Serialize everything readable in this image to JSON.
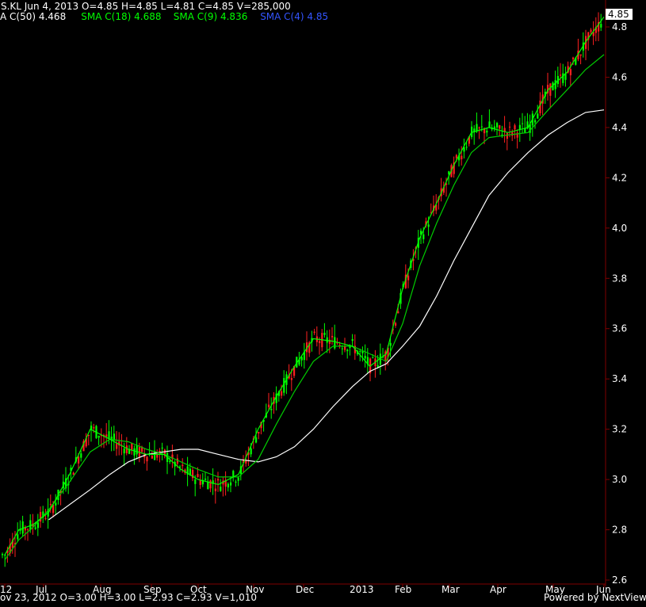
{
  "header": {
    "line1": "S.KL Jun 4, 2013   O=4.85   H=4.85   L=4.81   C=4.85   V=285,000",
    "sma_labels": [
      {
        "text": "A C(50) 4.468",
        "color": "#ffffff"
      },
      {
        "text": "SMA C(18) 4.688",
        "color": "#00ff00"
      },
      {
        "text": "SMA C(9) 4.836",
        "color": "#00ff00"
      },
      {
        "text": "SMA C(4) 4.85",
        "color": "#3355ff"
      }
    ]
  },
  "footer": {
    "hover_line": "ov 23, 2012   O=3.00   H=3.00   L=2.93   C=2.93   V=1,010",
    "powered_by": "Powered by NextView"
  },
  "colors": {
    "background": "#000000",
    "up_candle": "#00ff00",
    "down_candle": "#ff2020",
    "sma50": "#ffffff",
    "sma18": "#00cc00",
    "sma9": "#00ff00",
    "axis": "#800000",
    "text": "#ffffff",
    "last_price_box": "#ffffff"
  },
  "chart_data": {
    "type": "line",
    "title": "S.KL",
    "x_ticks": [
      "12",
      "Jul",
      "Aug",
      "Sep",
      "Oct",
      "Nov",
      "Dec",
      "2013",
      "Feb",
      "Mar",
      "Apr",
      "May",
      "Jun"
    ],
    "y_ticks": [
      2.6,
      2.8,
      3.0,
      3.2,
      3.4,
      3.6,
      3.8,
      4.0,
      4.2,
      4.4,
      4.6,
      4.8
    ],
    "ylim": [
      2.6,
      4.9
    ],
    "last_price": 4.85,
    "series": [
      {
        "name": "C(50)",
        "color": "#ffffff",
        "x": [
          7.5,
          8,
          8.5,
          9,
          9.5,
          10,
          10.5,
          11,
          11.5,
          12,
          12.5,
          13,
          13.5,
          14,
          14.5,
          15,
          15.5,
          16,
          16.5,
          17,
          17.5,
          18,
          18.5,
          19,
          19.5,
          20,
          20.5,
          21,
          21.5,
          22,
          22.5
        ],
        "values": [
          2.84,
          2.9,
          2.96,
          3.02,
          3.07,
          3.1,
          3.11,
          3.12,
          3.12,
          3.1,
          3.08,
          3.07,
          3.09,
          3.13,
          3.2,
          3.29,
          3.37,
          3.43,
          3.46,
          3.53,
          3.61,
          3.73,
          3.87,
          4.0,
          4.13,
          4.22,
          4.3,
          4.37,
          4.42,
          4.46,
          4.47
        ]
      },
      {
        "name": "C(18)",
        "color": "#00cc00",
        "x": [
          6,
          6.5,
          7,
          7.5,
          8,
          8.5,
          9,
          9.5,
          10,
          10.5,
          11,
          11.5,
          12,
          12.5,
          13,
          13.5,
          14,
          14.5,
          15,
          15.5,
          16,
          16.5,
          17,
          17.5,
          18,
          18.5,
          19,
          19.5,
          20,
          20.5,
          21,
          21.5,
          22,
          22.5
        ],
        "values": [
          2.68,
          2.76,
          2.81,
          2.88,
          2.99,
          3.11,
          3.16,
          3.15,
          3.12,
          3.1,
          3.07,
          3.04,
          3.01,
          3.01,
          3.08,
          3.22,
          3.35,
          3.47,
          3.53,
          3.53,
          3.5,
          3.47,
          3.62,
          3.85,
          4.02,
          4.17,
          4.3,
          4.36,
          4.37,
          4.38,
          4.47,
          4.55,
          4.63,
          4.69
        ]
      },
      {
        "name": "C(9)",
        "color": "#00ff00",
        "x": [
          6,
          6.5,
          7,
          7.5,
          8,
          8.5,
          9,
          9.5,
          10,
          10.5,
          11,
          11.5,
          12,
          12.5,
          13,
          13.5,
          14,
          14.5,
          15,
          15.5,
          16,
          16.5,
          17,
          17.5,
          18,
          18.5,
          19,
          19.5,
          20,
          20.5,
          21,
          21.5,
          22,
          22.5
        ],
        "values": [
          2.7,
          2.8,
          2.82,
          2.87,
          3.02,
          3.2,
          3.16,
          3.12,
          3.1,
          3.1,
          3.04,
          3.0,
          2.98,
          3.02,
          3.2,
          3.33,
          3.45,
          3.56,
          3.55,
          3.53,
          3.45,
          3.5,
          3.76,
          3.96,
          4.1,
          4.25,
          4.38,
          4.4,
          4.38,
          4.4,
          4.55,
          4.62,
          4.74,
          4.84
        ]
      }
    ]
  }
}
